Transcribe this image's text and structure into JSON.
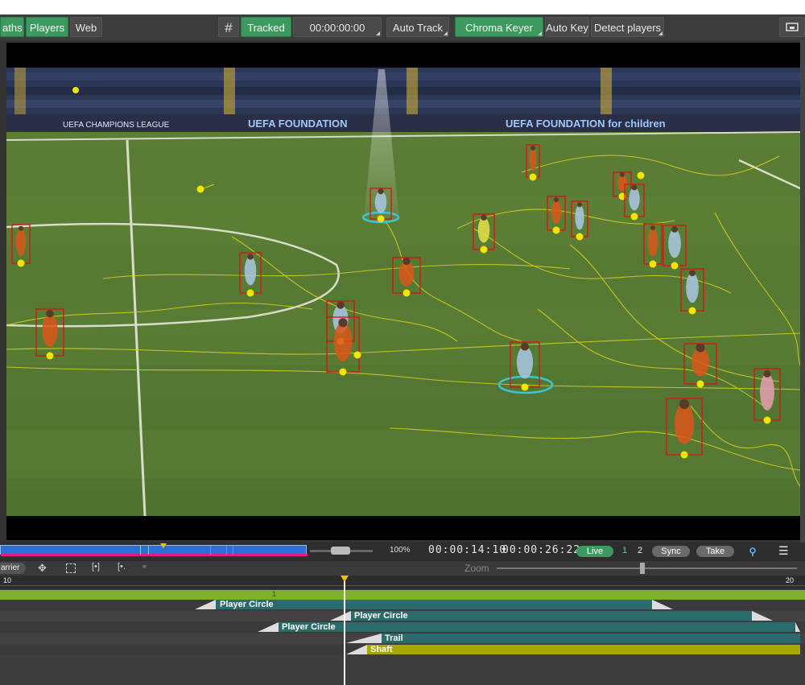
{
  "toolbar": {
    "tab_paths": "aths",
    "tab_players": "Players",
    "tab_web": "Web",
    "grid_icon": "grid-icon",
    "tracked_label": "Tracked",
    "timecode": "00:00:00:00",
    "auto_track_label": "Auto Track",
    "chroma_keyer_label": "Chroma Keyer",
    "auto_key_label": "Auto Key",
    "detect_players_label": "Detect players",
    "monitor_icon": "monitor-icon"
  },
  "video": {
    "banner_left": "UEFA CHAMPIONS LEAGUE",
    "banner_center": "UEFA FOUNDATION",
    "banner_right": "UEFA FOUNDATION for children",
    "tracked_players_count": 23
  },
  "transport": {
    "zoom_percent": "100%",
    "current_time": "00:00:14:10",
    "duration": "00:00:26:22",
    "live_label": "Live",
    "channel_1": "1",
    "channel_2": "2",
    "sync_label": "Sync",
    "take_label": "Take",
    "pin_icon": "pin-icon",
    "menu_icon": "menu-icon",
    "playhead_fraction": 0.53
  },
  "timeline_tools": {
    "carrier_label": "arrier",
    "move_icon": "move-icon",
    "select_icon": "select-icon",
    "fit_icon": "fit-icon",
    "trim_icon": "trim-icon",
    "lock_icon": "lock-icon",
    "zoom_label": "Zoom",
    "zoom_value": 0.8
  },
  "ruler": {
    "start_label": "10",
    "end_label": "20",
    "marker_label": "1"
  },
  "tracks": [
    {
      "label": "Player Circle",
      "color": "#2b6b6b"
    },
    {
      "label": "Player Circle",
      "color": "#2b6b6b"
    },
    {
      "label": "Player Circle",
      "color": "#2b6b6b"
    },
    {
      "label": "Trail",
      "color": "#2b6b6b"
    },
    {
      "label": "Shaft",
      "color": "#a8a600"
    }
  ],
  "colors": {
    "accent_green": "#3c9a5f",
    "track_teal": "#2b6b6b",
    "shaft_yellow": "#a8a600",
    "timeline_green": "#7fb02a",
    "box_red": "#e01010",
    "marker_yellow": "#f2e600"
  }
}
